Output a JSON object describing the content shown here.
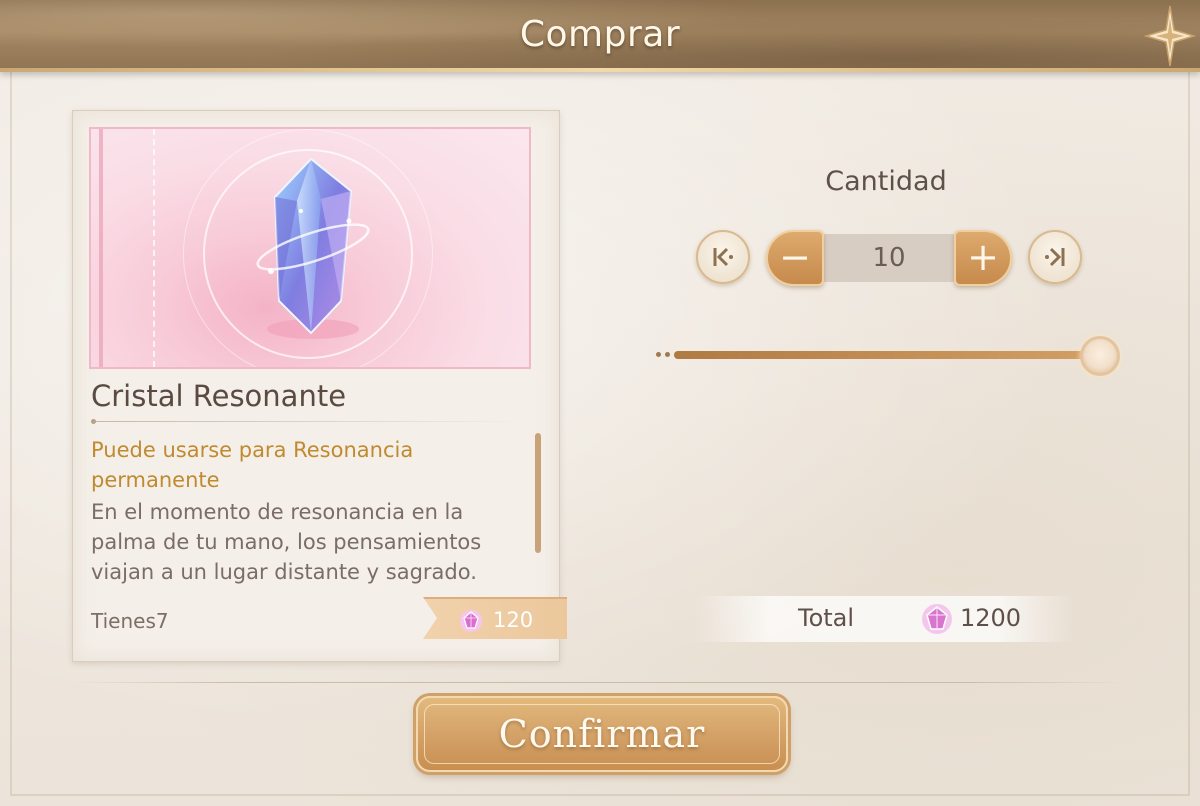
{
  "header": {
    "title": "Comprar",
    "corner_icon": "star-ornament-icon"
  },
  "item": {
    "name": "Cristal Resonante",
    "icon": "crystal-icon",
    "highlight": "Puede usarse para Resonancia permanente",
    "description": "En el momento de resonancia en la palma de tu mano, los pensamientos viajan a un lugar distante y sagrado.",
    "owned": "Tienes7",
    "unit_price": "120",
    "currency_icon": "pink-gem-icon"
  },
  "quantity": {
    "label": "Cantidad",
    "value": "10",
    "min_icon": "skip-to-min-icon",
    "max_icon": "skip-to-max-icon",
    "minus_label": "−",
    "plus_label": "+",
    "slider_level": 1.0
  },
  "total": {
    "label": "Total",
    "value": "1200"
  },
  "confirm": {
    "label": "Confirmar"
  },
  "colors": {
    "accent": "#c98f51",
    "highlight_text": "#c08a30",
    "card_pink": "#f8cbd9"
  }
}
